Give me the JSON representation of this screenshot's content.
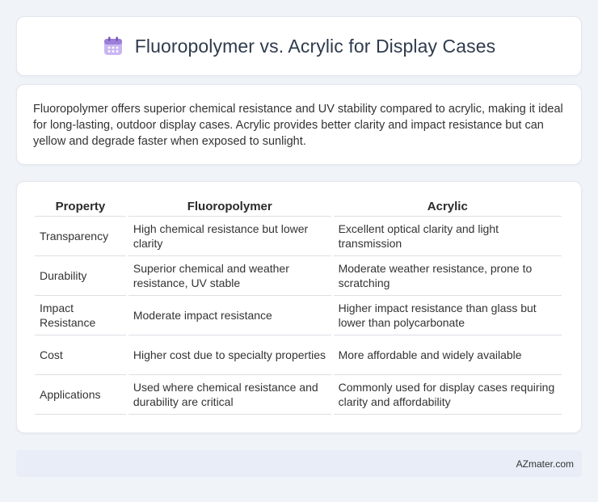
{
  "header": {
    "title": "Fluoropolymer vs. Acrylic for Display Cases",
    "icon": "calendar-icon",
    "icon_color": "#9b7fd8"
  },
  "summary": {
    "text": "Fluoropolymer offers superior chemical resistance and UV stability compared to acrylic, making it ideal for long-lasting, outdoor display cases. Acrylic provides better clarity and impact resistance but can yellow and degrade faster when exposed to sunlight."
  },
  "table": {
    "headers": [
      "Property",
      "Fluoropolymer",
      "Acrylic"
    ],
    "rows": [
      [
        "Transparency",
        "High chemical resistance but lower clarity",
        "Excellent optical clarity and light transmission"
      ],
      [
        "Durability",
        "Superior chemical and weather resistance, UV stable",
        "Moderate weather resistance, prone to scratching"
      ],
      [
        "Impact Resistance",
        "Moderate impact resistance",
        "Higher impact resistance than glass but lower than polycarbonate"
      ],
      [
        "Cost",
        "Higher cost due to specialty properties",
        "More affordable and widely available"
      ],
      [
        "Applications",
        "Used where chemical resistance and durability are critical",
        "Commonly used for display cases requiring clarity and affordability"
      ]
    ]
  },
  "footer": {
    "text": "AZmater.com"
  },
  "colors": {
    "background": "#f0f3f8",
    "card": "#ffffff",
    "footer_bg": "#e8edf7"
  }
}
